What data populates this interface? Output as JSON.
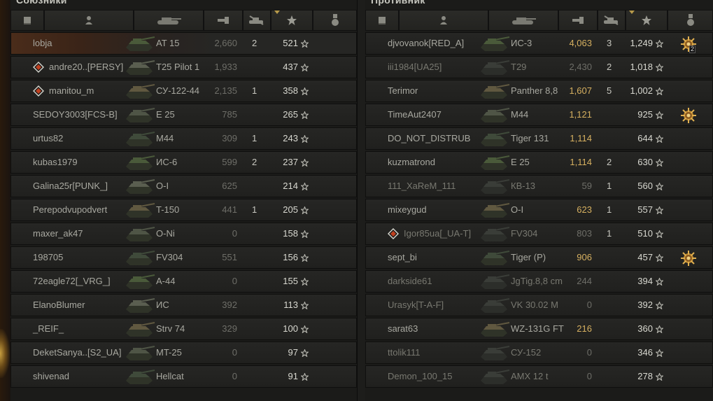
{
  "allies": {
    "title": "Союзники",
    "rows": [
      {
        "name": "lobja",
        "tank": "AT 15",
        "damage": "2,660",
        "kills": "2",
        "xp": "521",
        "self": true,
        "badge": false,
        "dmg_hi": false,
        "medal": null,
        "dead": false
      },
      {
        "name": "andre20..[PERSY]",
        "tank": "T25 Pilot 1",
        "damage": "1,933",
        "kills": "",
        "xp": "437",
        "self": false,
        "badge": true,
        "dmg_hi": false,
        "medal": null,
        "dead": false
      },
      {
        "name": "manitou_m",
        "tank": "СУ-122-44",
        "damage": "2,135",
        "kills": "1",
        "xp": "358",
        "self": false,
        "badge": true,
        "dmg_hi": false,
        "medal": null,
        "dead": false
      },
      {
        "name": "SEDOY3003[FCS-B]",
        "tank": "E 25",
        "damage": "785",
        "kills": "",
        "xp": "265",
        "self": false,
        "badge": false,
        "dmg_hi": false,
        "medal": null,
        "dead": false
      },
      {
        "name": "urtus82",
        "tank": "M44",
        "damage": "309",
        "kills": "1",
        "xp": "243",
        "self": false,
        "badge": false,
        "dmg_hi": false,
        "medal": null,
        "dead": false
      },
      {
        "name": "kubas1979",
        "tank": "ИС-6",
        "damage": "599",
        "kills": "2",
        "xp": "237",
        "self": false,
        "badge": false,
        "dmg_hi": false,
        "medal": null,
        "dead": false
      },
      {
        "name": "Galina25r[PUNK_]",
        "tank": "O-I",
        "damage": "625",
        "kills": "",
        "xp": "214",
        "self": false,
        "badge": false,
        "dmg_hi": false,
        "medal": null,
        "dead": false
      },
      {
        "name": "Perepodvupodvert",
        "tank": "T-150",
        "damage": "441",
        "kills": "1",
        "xp": "205",
        "self": false,
        "badge": false,
        "dmg_hi": false,
        "medal": null,
        "dead": false
      },
      {
        "name": "maxer_ak47",
        "tank": "O-Ni",
        "damage": "0",
        "kills": "",
        "xp": "158",
        "self": false,
        "badge": false,
        "dmg_hi": false,
        "medal": null,
        "dead": false
      },
      {
        "name": "198705",
        "tank": "FV304",
        "damage": "551",
        "kills": "",
        "xp": "156",
        "self": false,
        "badge": false,
        "dmg_hi": false,
        "medal": null,
        "dead": false
      },
      {
        "name": "72eagle72[_VRG_]",
        "tank": "A-44",
        "damage": "0",
        "kills": "",
        "xp": "155",
        "self": false,
        "badge": false,
        "dmg_hi": false,
        "medal": null,
        "dead": false
      },
      {
        "name": "ElanoBlumer",
        "tank": "ИС",
        "damage": "392",
        "kills": "",
        "xp": "113",
        "self": false,
        "badge": false,
        "dmg_hi": false,
        "medal": null,
        "dead": false
      },
      {
        "name": "_REIF_",
        "tank": "Strv 74",
        "damage": "329",
        "kills": "",
        "xp": "100",
        "self": false,
        "badge": false,
        "dmg_hi": false,
        "medal": null,
        "dead": false
      },
      {
        "name": "DeketSanya..[S2_UA]",
        "tank": "MT-25",
        "damage": "0",
        "kills": "",
        "xp": "97",
        "self": false,
        "badge": false,
        "dmg_hi": false,
        "medal": null,
        "dead": false
      },
      {
        "name": "shivenad",
        "tank": "Hellcat",
        "damage": "0",
        "kills": "",
        "xp": "91",
        "self": false,
        "badge": false,
        "dmg_hi": false,
        "medal": null,
        "dead": false
      }
    ]
  },
  "enemies": {
    "title": "Противник",
    "rows": [
      {
        "name": "djvovanok[RED_A]",
        "tank": "ИС-3",
        "damage": "4,063",
        "kills": "3",
        "xp": "1,249",
        "self": false,
        "badge": false,
        "dmg_hi": true,
        "medal": "2",
        "dead": false
      },
      {
        "name": "iii1984[UA25]",
        "tank": "T29",
        "damage": "2,430",
        "kills": "2",
        "xp": "1,018",
        "self": false,
        "badge": false,
        "dmg_hi": false,
        "medal": null,
        "dead": true
      },
      {
        "name": "Terimor",
        "tank": "Panther 8,8",
        "damage": "1,607",
        "kills": "5",
        "xp": "1,002",
        "self": false,
        "badge": false,
        "dmg_hi": true,
        "medal": null,
        "dead": false
      },
      {
        "name": "TimeAut2407",
        "tank": "M44",
        "damage": "1,121",
        "kills": "",
        "xp": "925",
        "self": false,
        "badge": false,
        "dmg_hi": true,
        "medal": "",
        "dead": false
      },
      {
        "name": "DO_NOT_DISTRUB",
        "tank": "Tiger 131",
        "damage": "1,114",
        "kills": "",
        "xp": "644",
        "self": false,
        "badge": false,
        "dmg_hi": true,
        "medal": null,
        "dead": false
      },
      {
        "name": "kuzmatrond",
        "tank": "E 25",
        "damage": "1,114",
        "kills": "2",
        "xp": "630",
        "self": false,
        "badge": false,
        "dmg_hi": true,
        "medal": null,
        "dead": false
      },
      {
        "name": "111_XaReM_111",
        "tank": "КВ-13",
        "damage": "59",
        "kills": "1",
        "xp": "560",
        "self": false,
        "badge": false,
        "dmg_hi": false,
        "medal": null,
        "dead": true
      },
      {
        "name": "mixeygud",
        "tank": "O-I",
        "damage": "623",
        "kills": "1",
        "xp": "557",
        "self": false,
        "badge": false,
        "dmg_hi": true,
        "medal": null,
        "dead": false
      },
      {
        "name": "Igor85ua[_UA-T]",
        "tank": "FV304",
        "damage": "803",
        "kills": "1",
        "xp": "510",
        "self": false,
        "badge": true,
        "dmg_hi": false,
        "medal": null,
        "dead": true
      },
      {
        "name": "sept_bi",
        "tank": "Tiger (P)",
        "damage": "906",
        "kills": "",
        "xp": "457",
        "self": false,
        "badge": false,
        "dmg_hi": true,
        "medal": "",
        "dead": false
      },
      {
        "name": "darkside61",
        "tank": "JgTig.8,8 cm",
        "damage": "244",
        "kills": "",
        "xp": "394",
        "self": false,
        "badge": false,
        "dmg_hi": false,
        "medal": null,
        "dead": true
      },
      {
        "name": "Urasyk[T-A-F]",
        "tank": "VK 30.02 M",
        "damage": "0",
        "kills": "",
        "xp": "392",
        "self": false,
        "badge": false,
        "dmg_hi": false,
        "medal": null,
        "dead": true
      },
      {
        "name": "sarat63",
        "tank": "WZ-131G FT",
        "damage": "216",
        "kills": "",
        "xp": "360",
        "self": false,
        "badge": false,
        "dmg_hi": true,
        "medal": null,
        "dead": false
      },
      {
        "name": "ttolik111",
        "tank": "СУ-152",
        "damage": "0",
        "kills": "",
        "xp": "346",
        "self": false,
        "badge": false,
        "dmg_hi": false,
        "medal": null,
        "dead": true
      },
      {
        "name": "Demon_100_15",
        "tank": "AMX 12 t",
        "damage": "0",
        "kills": "",
        "xp": "278",
        "self": false,
        "badge": false,
        "dmg_hi": false,
        "medal": null,
        "dead": true
      }
    ]
  },
  "icons": {
    "header": [
      "platoon-icon",
      "player-icon",
      "tank-icon",
      "damage-icon",
      "kills-icon",
      "experience-star-icon",
      "medal-icon"
    ],
    "row_xp": "star-icon"
  },
  "colors": {
    "accent_gold": "#d6b060",
    "text_main": "#a8a8a0",
    "text_dim": "#787870",
    "self_row": "#4a2c1a"
  }
}
